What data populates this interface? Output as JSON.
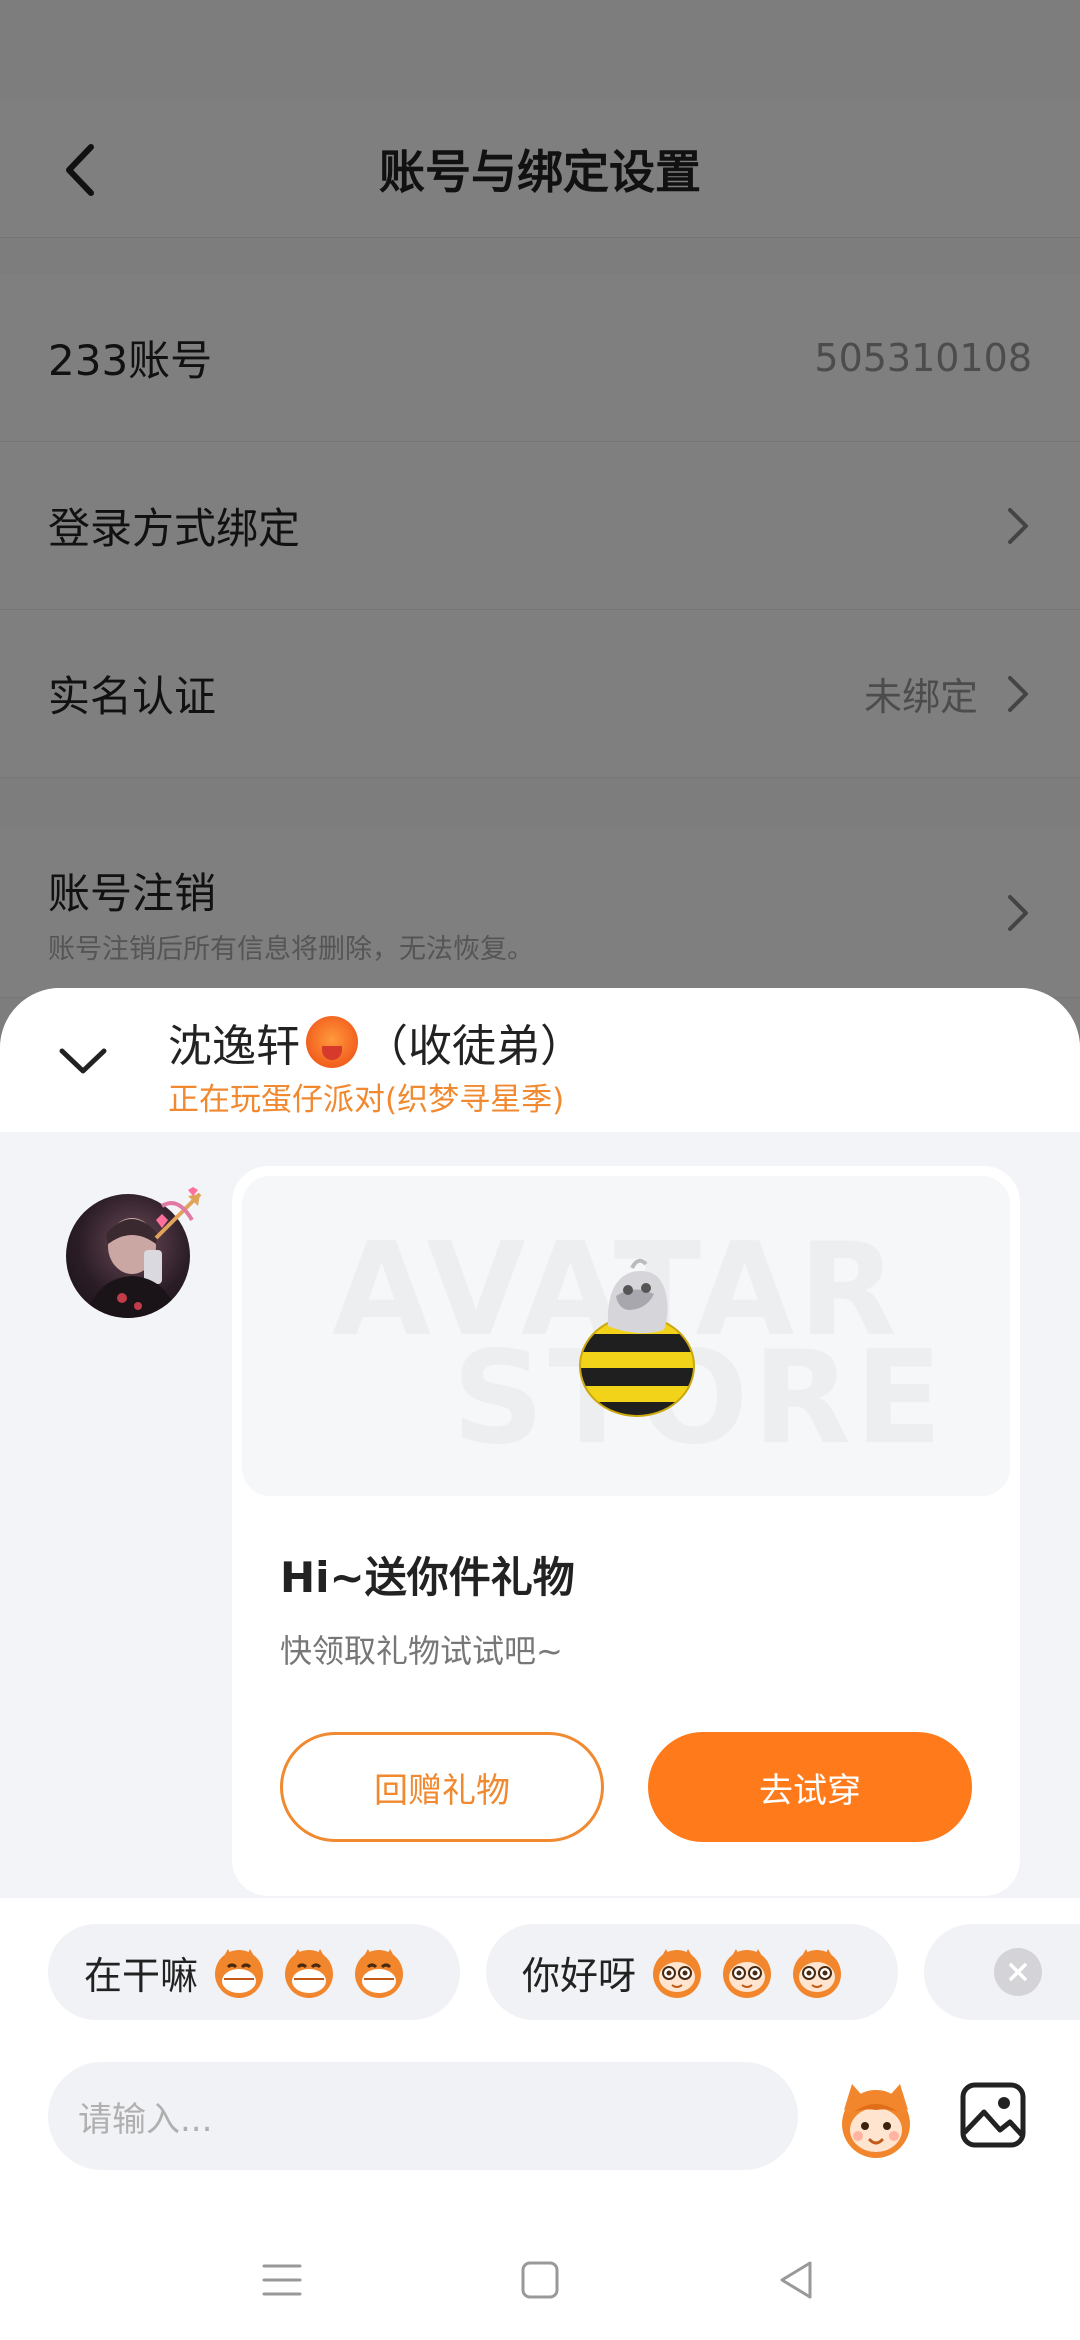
{
  "background_page": {
    "title": "账号与绑定设置",
    "rows": [
      {
        "label": "233账号",
        "value": "505310108"
      },
      {
        "label": "登录方式绑定",
        "value": ""
      },
      {
        "label": "实名认证",
        "value": "未绑定"
      }
    ],
    "cancel_row": {
      "label": "账号注销",
      "sub": "账号注销后所有信息将删除，无法恢复。"
    }
  },
  "sheet": {
    "name": "沈逸轩",
    "name_suffix": "（收徒弟）",
    "status": "正在玩蛋仔派对(织梦寻星季)",
    "card": {
      "watermark_1": "AVATAR",
      "watermark_2": "STORE",
      "title": "Hi~送你件礼物",
      "subtitle": "快领取礼物试试吧~",
      "btn_return": "回赠礼物",
      "btn_try": "去试穿"
    }
  },
  "quick_replies": [
    {
      "text": "在干嘛"
    },
    {
      "text": "你好呀"
    }
  ],
  "input": {
    "placeholder": "请输入..."
  },
  "colors": {
    "accent": "#ff7a1a",
    "accent_text": "#f0892f",
    "chip_bg": "#f1f2f5",
    "sheet_bg": "#f3f4f8"
  }
}
